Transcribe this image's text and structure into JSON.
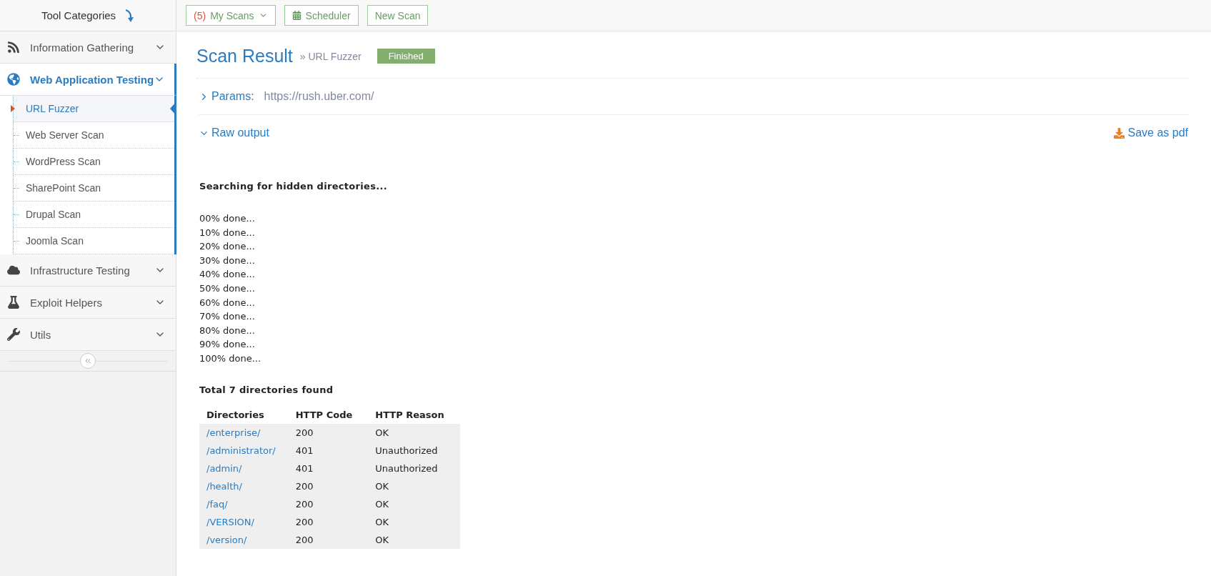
{
  "sidebar": {
    "title": "Tool Categories",
    "categories": [
      {
        "label": "Information Gathering",
        "expanded": false
      },
      {
        "label": "Web Application Testing",
        "expanded": true,
        "children": [
          {
            "label": "URL Fuzzer",
            "selected": true
          },
          {
            "label": "Web Server Scan",
            "selected": false
          },
          {
            "label": "WordPress Scan",
            "selected": false
          },
          {
            "label": "SharePoint Scan",
            "selected": false
          },
          {
            "label": "Drupal Scan",
            "selected": false
          },
          {
            "label": "Joomla Scan",
            "selected": false
          }
        ]
      },
      {
        "label": "Infrastructure Testing",
        "expanded": false
      },
      {
        "label": "Exploit Helpers",
        "expanded": false
      },
      {
        "label": "Utils",
        "expanded": false
      }
    ]
  },
  "toolbar": {
    "my_scans": {
      "count": "(5)",
      "label": "My Scans"
    },
    "scheduler": "Scheduler",
    "new_scan": "New Scan"
  },
  "header": {
    "title": "Scan Result",
    "breadcrumb": "» URL Fuzzer",
    "status": "Finished"
  },
  "params": {
    "label": "Params:",
    "value": "https://rush.uber.com/",
    "expanded": false
  },
  "raw_output": {
    "label": "Raw output",
    "expanded": true,
    "save": "Save as pdf"
  },
  "output": {
    "heading": "Searching for hidden directories...",
    "progress": [
      "00% done...",
      "10% done...",
      "20% done...",
      "30% done...",
      "40% done...",
      "50% done...",
      "60% done...",
      "70% done...",
      "80% done...",
      "90% done...",
      "100% done..."
    ],
    "total": "Total 7 directories found",
    "table": {
      "columns": [
        "Directories",
        "HTTP Code",
        "HTTP Reason"
      ],
      "rows": [
        [
          "/enterprise/",
          "200",
          "OK"
        ],
        [
          "/administrator/",
          "401",
          "Unauthorized"
        ],
        [
          "/admin/",
          "401",
          "Unauthorized"
        ],
        [
          "/health/",
          "200",
          "OK"
        ],
        [
          "/faq/",
          "200",
          "OK"
        ],
        [
          "/VERSION/",
          "200",
          "OK"
        ],
        [
          "/version/",
          "200",
          "OK"
        ]
      ]
    }
  }
}
